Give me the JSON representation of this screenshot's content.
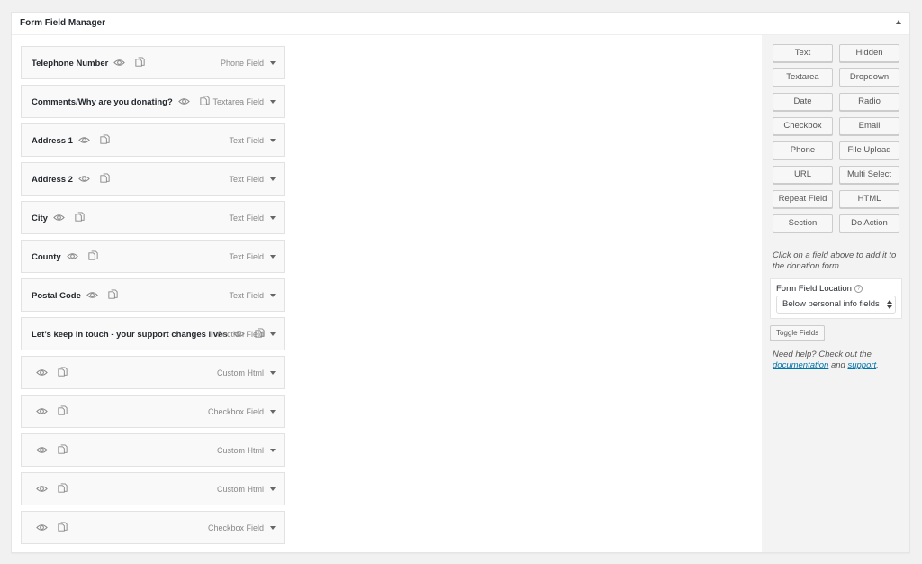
{
  "panel": {
    "title": "Form Field Manager",
    "collapse_icon": "triangle-up-icon"
  },
  "fields": [
    {
      "label": "Telephone Number",
      "type": "Phone Field"
    },
    {
      "label": "Comments/Why are you donating?",
      "type": "Textarea Field"
    },
    {
      "label": "Address 1",
      "type": "Text Field"
    },
    {
      "label": "Address 2",
      "type": "Text Field"
    },
    {
      "label": "City",
      "type": "Text Field"
    },
    {
      "label": "County",
      "type": "Text Field"
    },
    {
      "label": "Postal Code",
      "type": "Text Field"
    },
    {
      "label": "Let’s keep in touch - your support changes lives",
      "type": "Section Field"
    },
    {
      "label": "",
      "type": "Custom Html"
    },
    {
      "label": "",
      "type": "Checkbox Field"
    },
    {
      "label": "",
      "type": "Custom Html"
    },
    {
      "label": "",
      "type": "Custom Html"
    },
    {
      "label": "",
      "type": "Checkbox Field"
    }
  ],
  "field_icons": {
    "visibility": "eye-icon",
    "duplicate": "copy-icon",
    "expand": "caret-down-icon"
  },
  "sidebar": {
    "add_buttons": [
      "Text",
      "Hidden",
      "Textarea",
      "Dropdown",
      "Date",
      "Radio",
      "Checkbox",
      "Email",
      "Phone",
      "File Upload",
      "URL",
      "Multi Select",
      "Repeat Field",
      "HTML",
      "Section",
      "Do Action"
    ],
    "help_text": "Click on a field above to add it to the donation form.",
    "location": {
      "label": "Form Field Location",
      "help_icon": "question-circle-icon",
      "selected": "Below personal info fields"
    },
    "toggle_label": "Toggle Fields",
    "need_help": {
      "prefix": "Need help? Check out the",
      "link1": "documentation",
      "middle": "and",
      "link2": "support",
      "suffix": "."
    }
  },
  "colors": {
    "link": "#0073aa",
    "page_bg": "#f1f1f1",
    "sidebar_bg": "#f3f3f3"
  }
}
